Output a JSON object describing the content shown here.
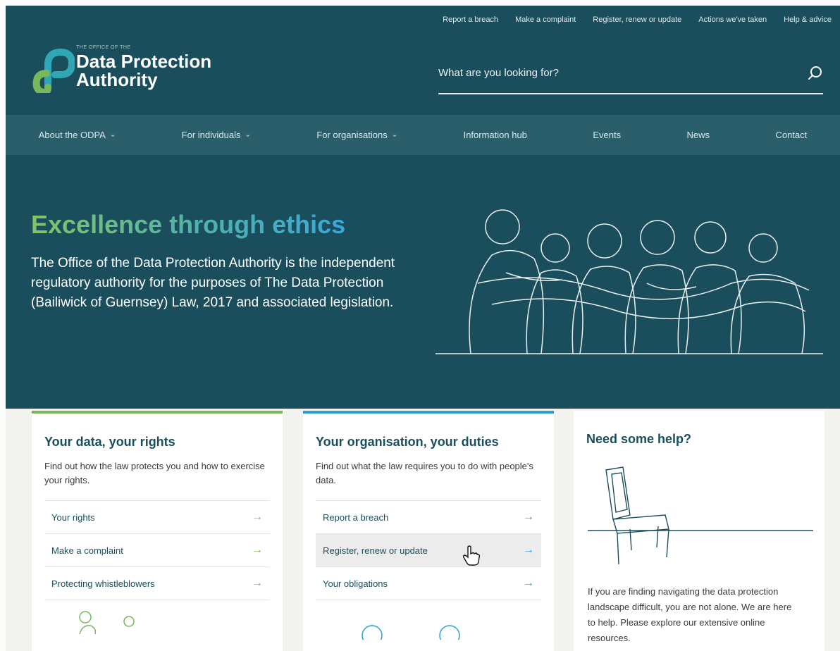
{
  "utility_links": [
    "Report a breach",
    "Make a complaint",
    "Register, renew or update",
    "Actions we've taken",
    "Help & advice"
  ],
  "logo": {
    "small_text": "THE OFFICE OF THE",
    "line1": "Data Protection",
    "line2": "Authority"
  },
  "search": {
    "placeholder": "What are you looking for?",
    "icon": "search-icon"
  },
  "nav": [
    {
      "label": "About the ODPA",
      "dropdown": true
    },
    {
      "label": "For individuals",
      "dropdown": true
    },
    {
      "label": "For organisations",
      "dropdown": true
    },
    {
      "label": "Information hub",
      "dropdown": false
    },
    {
      "label": "Events",
      "dropdown": false
    },
    {
      "label": "News",
      "dropdown": false
    },
    {
      "label": "Contact",
      "dropdown": false
    }
  ],
  "hero": {
    "title": "Excellence through ethics",
    "body": "The Office of the Data Protection Authority is the independent regulatory authority for the purposes of The Data Protection (Bailiwick of Guernsey) Law, 2017 and associated legislation."
  },
  "cards": [
    {
      "title": "Your data, your rights",
      "desc": "Find out how the law protects you and how to exercise your rights.",
      "links": [
        "Your rights",
        "Make a complaint",
        "Protecting whistleblowers"
      ]
    },
    {
      "title": "Your organisation, your duties",
      "desc": "Find out what the law requires you to do with people's data.",
      "links": [
        "Report a breach",
        "Register, renew or update",
        "Your obligations"
      ]
    },
    {
      "title": "Need some help?",
      "desc": "If you are finding navigating the data protection landscape difficult, you are not alone. We are here to help. Please explore our extensive online resources."
    }
  ],
  "colors": {
    "background": "#1b4e5c",
    "nav": "#2b5e6b",
    "accent_green": "#79b85a",
    "accent_blue": "#2f9fd2"
  }
}
